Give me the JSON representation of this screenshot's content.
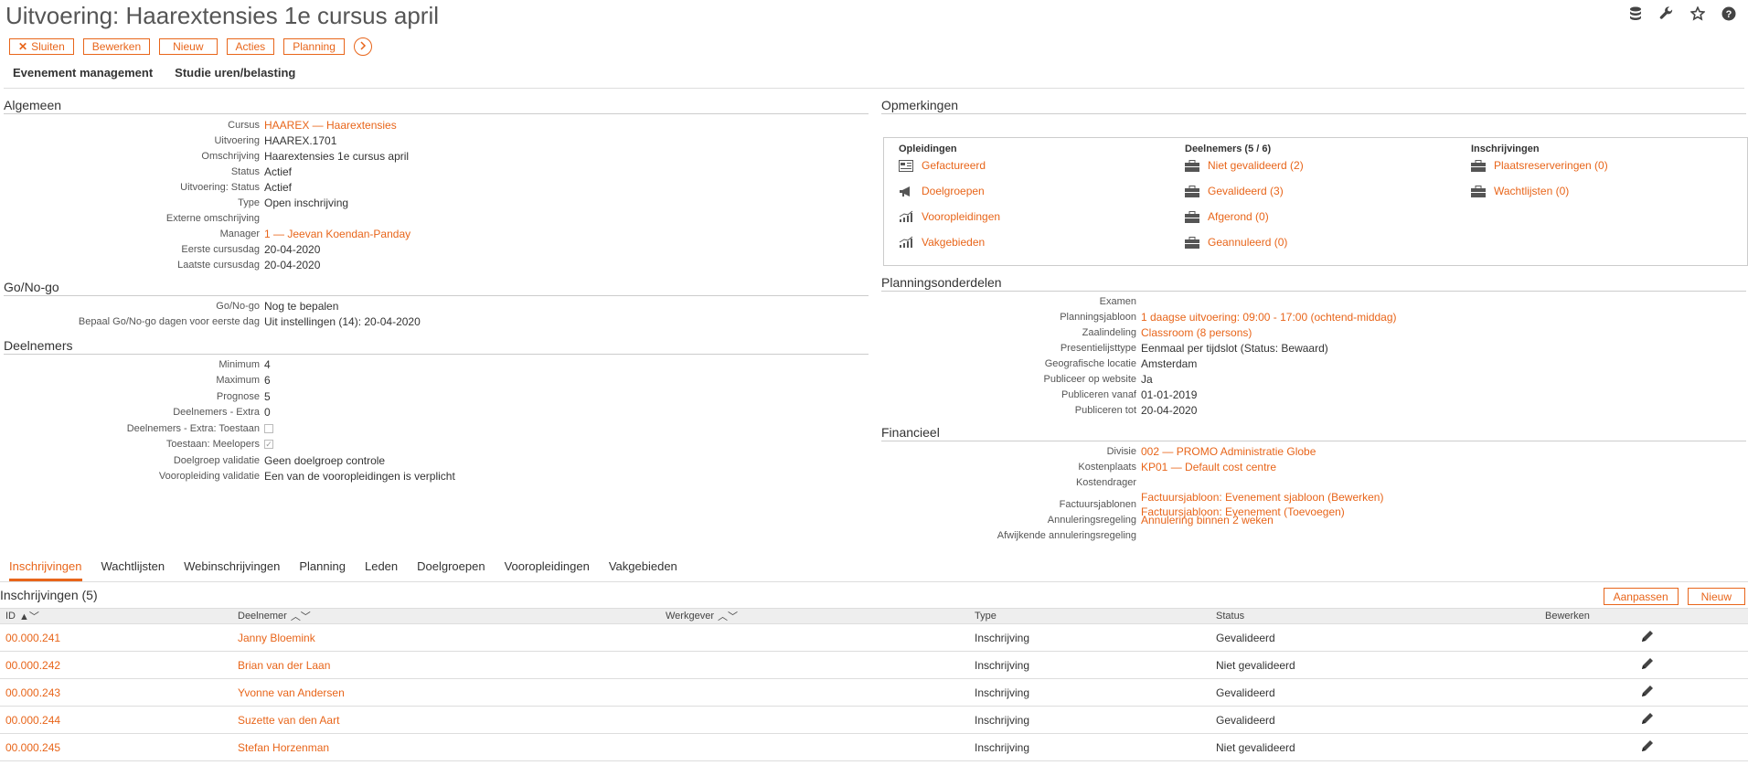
{
  "header": {
    "title": "Uitvoering: Haarextensies 1e cursus april"
  },
  "toolbar": {
    "close": "Sluiten",
    "edit": "Bewerken",
    "new": "Nieuw",
    "actions": "Acties",
    "planning": "Planning"
  },
  "top_tabs": [
    "Evenement management",
    "Studie uren/belasting"
  ],
  "algemeen": {
    "title": "Algemeen",
    "rows": [
      {
        "label": "Cursus",
        "value": "HAAREX — Haarextensies",
        "link": true
      },
      {
        "label": "Uitvoering",
        "value": "HAAREX.1701"
      },
      {
        "label": "Omschrijving",
        "value": "Haarextensies 1e cursus april"
      },
      {
        "label": "Status",
        "value": "Actief"
      },
      {
        "label": "Uitvoering: Status",
        "value": "Actief"
      },
      {
        "label": "Type",
        "value": "Open inschrijving"
      },
      {
        "label": "Externe omschrijving",
        "value": ""
      },
      {
        "label": "Manager",
        "value": "1 — Jeevan Koendan-Panday",
        "link": true
      },
      {
        "label": "Eerste cursusdag",
        "value": "20-04-2020"
      },
      {
        "label": "Laatste cursusdag",
        "value": "20-04-2020"
      }
    ]
  },
  "gonogo": {
    "title": "Go/No-go",
    "rows": [
      {
        "label": "Go/No-go",
        "value": "Nog te bepalen"
      },
      {
        "label": "Bepaal Go/No-go dagen voor eerste dag",
        "value": "Uit instellingen (14): 20-04-2020"
      }
    ]
  },
  "deelnemers": {
    "title": "Deelnemers",
    "rows": [
      {
        "label": "Minimum",
        "value": "4"
      },
      {
        "label": "Maximum",
        "value": "6"
      },
      {
        "label": "Prognose",
        "value": "5"
      },
      {
        "label": "Deelnemers - Extra",
        "value": "0"
      },
      {
        "label": "Deelnemers - Extra: Toestaan",
        "value": "",
        "checkbox": false
      },
      {
        "label": "Toestaan: Meelopers",
        "value": "",
        "checkbox": true
      },
      {
        "label": "Doelgroep validatie",
        "value": "Geen doelgroep controle"
      },
      {
        "label": "Vooropleiding validatie",
        "value": "Een van de vooropleidingen is verplicht"
      }
    ]
  },
  "opmerkingen": {
    "title": "Opmerkingen",
    "columns": [
      {
        "heading": "Opleidingen",
        "items": [
          {
            "label": "Gefactureerd",
            "icon": "invoice-icon"
          },
          {
            "label": "Doelgroepen",
            "icon": "megaphone-icon"
          },
          {
            "label": "Vooropleidingen",
            "icon": "chart-icon"
          },
          {
            "label": "Vakgebieden",
            "icon": "chart-icon"
          }
        ]
      },
      {
        "heading": "Deelnemers (5 / 6)",
        "items": [
          {
            "label": "Niet gevalideerd (2)",
            "icon": "briefcase-icon"
          },
          {
            "label": "Gevalideerd (3)",
            "icon": "briefcase-icon"
          },
          {
            "label": "Afgerond (0)",
            "icon": "briefcase-icon"
          },
          {
            "label": "Geannuleerd (0)",
            "icon": "briefcase-icon"
          }
        ]
      },
      {
        "heading": "Inschrijvingen",
        "items": [
          {
            "label": "Plaatsreserveringen (0)",
            "icon": "briefcase-icon"
          },
          {
            "label": "Wachtlijsten (0)",
            "icon": "briefcase-icon"
          }
        ]
      }
    ]
  },
  "planning": {
    "title": "Planningsonderdelen",
    "rows": [
      {
        "label": "Examen",
        "value": ""
      },
      {
        "label": "Planningsjabloon",
        "value": "1 daagse uitvoering: 09:00 - 17:00 (ochtend-middag)",
        "link": true
      },
      {
        "label": "Zaalindeling",
        "value": "Classroom (8 persons)",
        "link": true
      },
      {
        "label": "Presentielijsttype",
        "value": "Eenmaal per tijdslot (Status: Bewaard)"
      },
      {
        "label": "Geografische locatie",
        "value": "Amsterdam"
      },
      {
        "label": "Publiceer op website",
        "value": "Ja"
      },
      {
        "label": "Publiceren vanaf",
        "value": "01-01-2019"
      },
      {
        "label": "Publiceren tot",
        "value": "20-04-2020"
      }
    ]
  },
  "financieel": {
    "title": "Financieel",
    "rows": [
      {
        "label": "Divisie",
        "value": "002 — PROMO Administratie Globe",
        "link": true
      },
      {
        "label": "Kostenplaats",
        "value": "KP01 — Default cost centre",
        "link": true
      },
      {
        "label": "Kostendrager",
        "value": ""
      },
      {
        "label": "Factuursjablonen",
        "value": "Factuursjabloon: Evenement sjabloon (Bewerken)",
        "value2": "Factuursjabloon: Evenement (Toevoegen)",
        "link": true
      },
      {
        "label": "Annuleringsregeling",
        "value": "Annulering binnen 2 weken",
        "link": true
      },
      {
        "label": "Afwijkende annuleringsregeling",
        "value": ""
      }
    ]
  },
  "bottom_tabs": [
    "Inschrijvingen",
    "Wachtlijsten",
    "Webinschrijvingen",
    "Planning",
    "Leden",
    "Doelgroepen",
    "Vooropleidingen",
    "Vakgebieden"
  ],
  "inschrijvingen": {
    "title": "Inschrijvingen (5)",
    "btn_adjust": "Aanpassen",
    "btn_new": "Nieuw",
    "columns": [
      "ID",
      "Deelnemer",
      "Werkgever",
      "Type",
      "Status",
      "Bewerken"
    ],
    "rows": [
      {
        "id": "00.000.241",
        "name": "Janny Bloemink",
        "employer": "",
        "type": "Inschrijving",
        "status": "Gevalideerd"
      },
      {
        "id": "00.000.242",
        "name": "Brian van der Laan",
        "employer": "",
        "type": "Inschrijving",
        "status": "Niet gevalideerd"
      },
      {
        "id": "00.000.243",
        "name": "Yvonne van Andersen",
        "employer": "",
        "type": "Inschrijving",
        "status": "Gevalideerd"
      },
      {
        "id": "00.000.244",
        "name": "Suzette van den Aart",
        "employer": "",
        "type": "Inschrijving",
        "status": "Gevalideerd"
      },
      {
        "id": "00.000.245",
        "name": "Stefan Horzenman",
        "employer": "",
        "type": "Inschrijving",
        "status": "Niet gevalideerd"
      }
    ]
  },
  "colors": {
    "accent": "#e8651a"
  }
}
